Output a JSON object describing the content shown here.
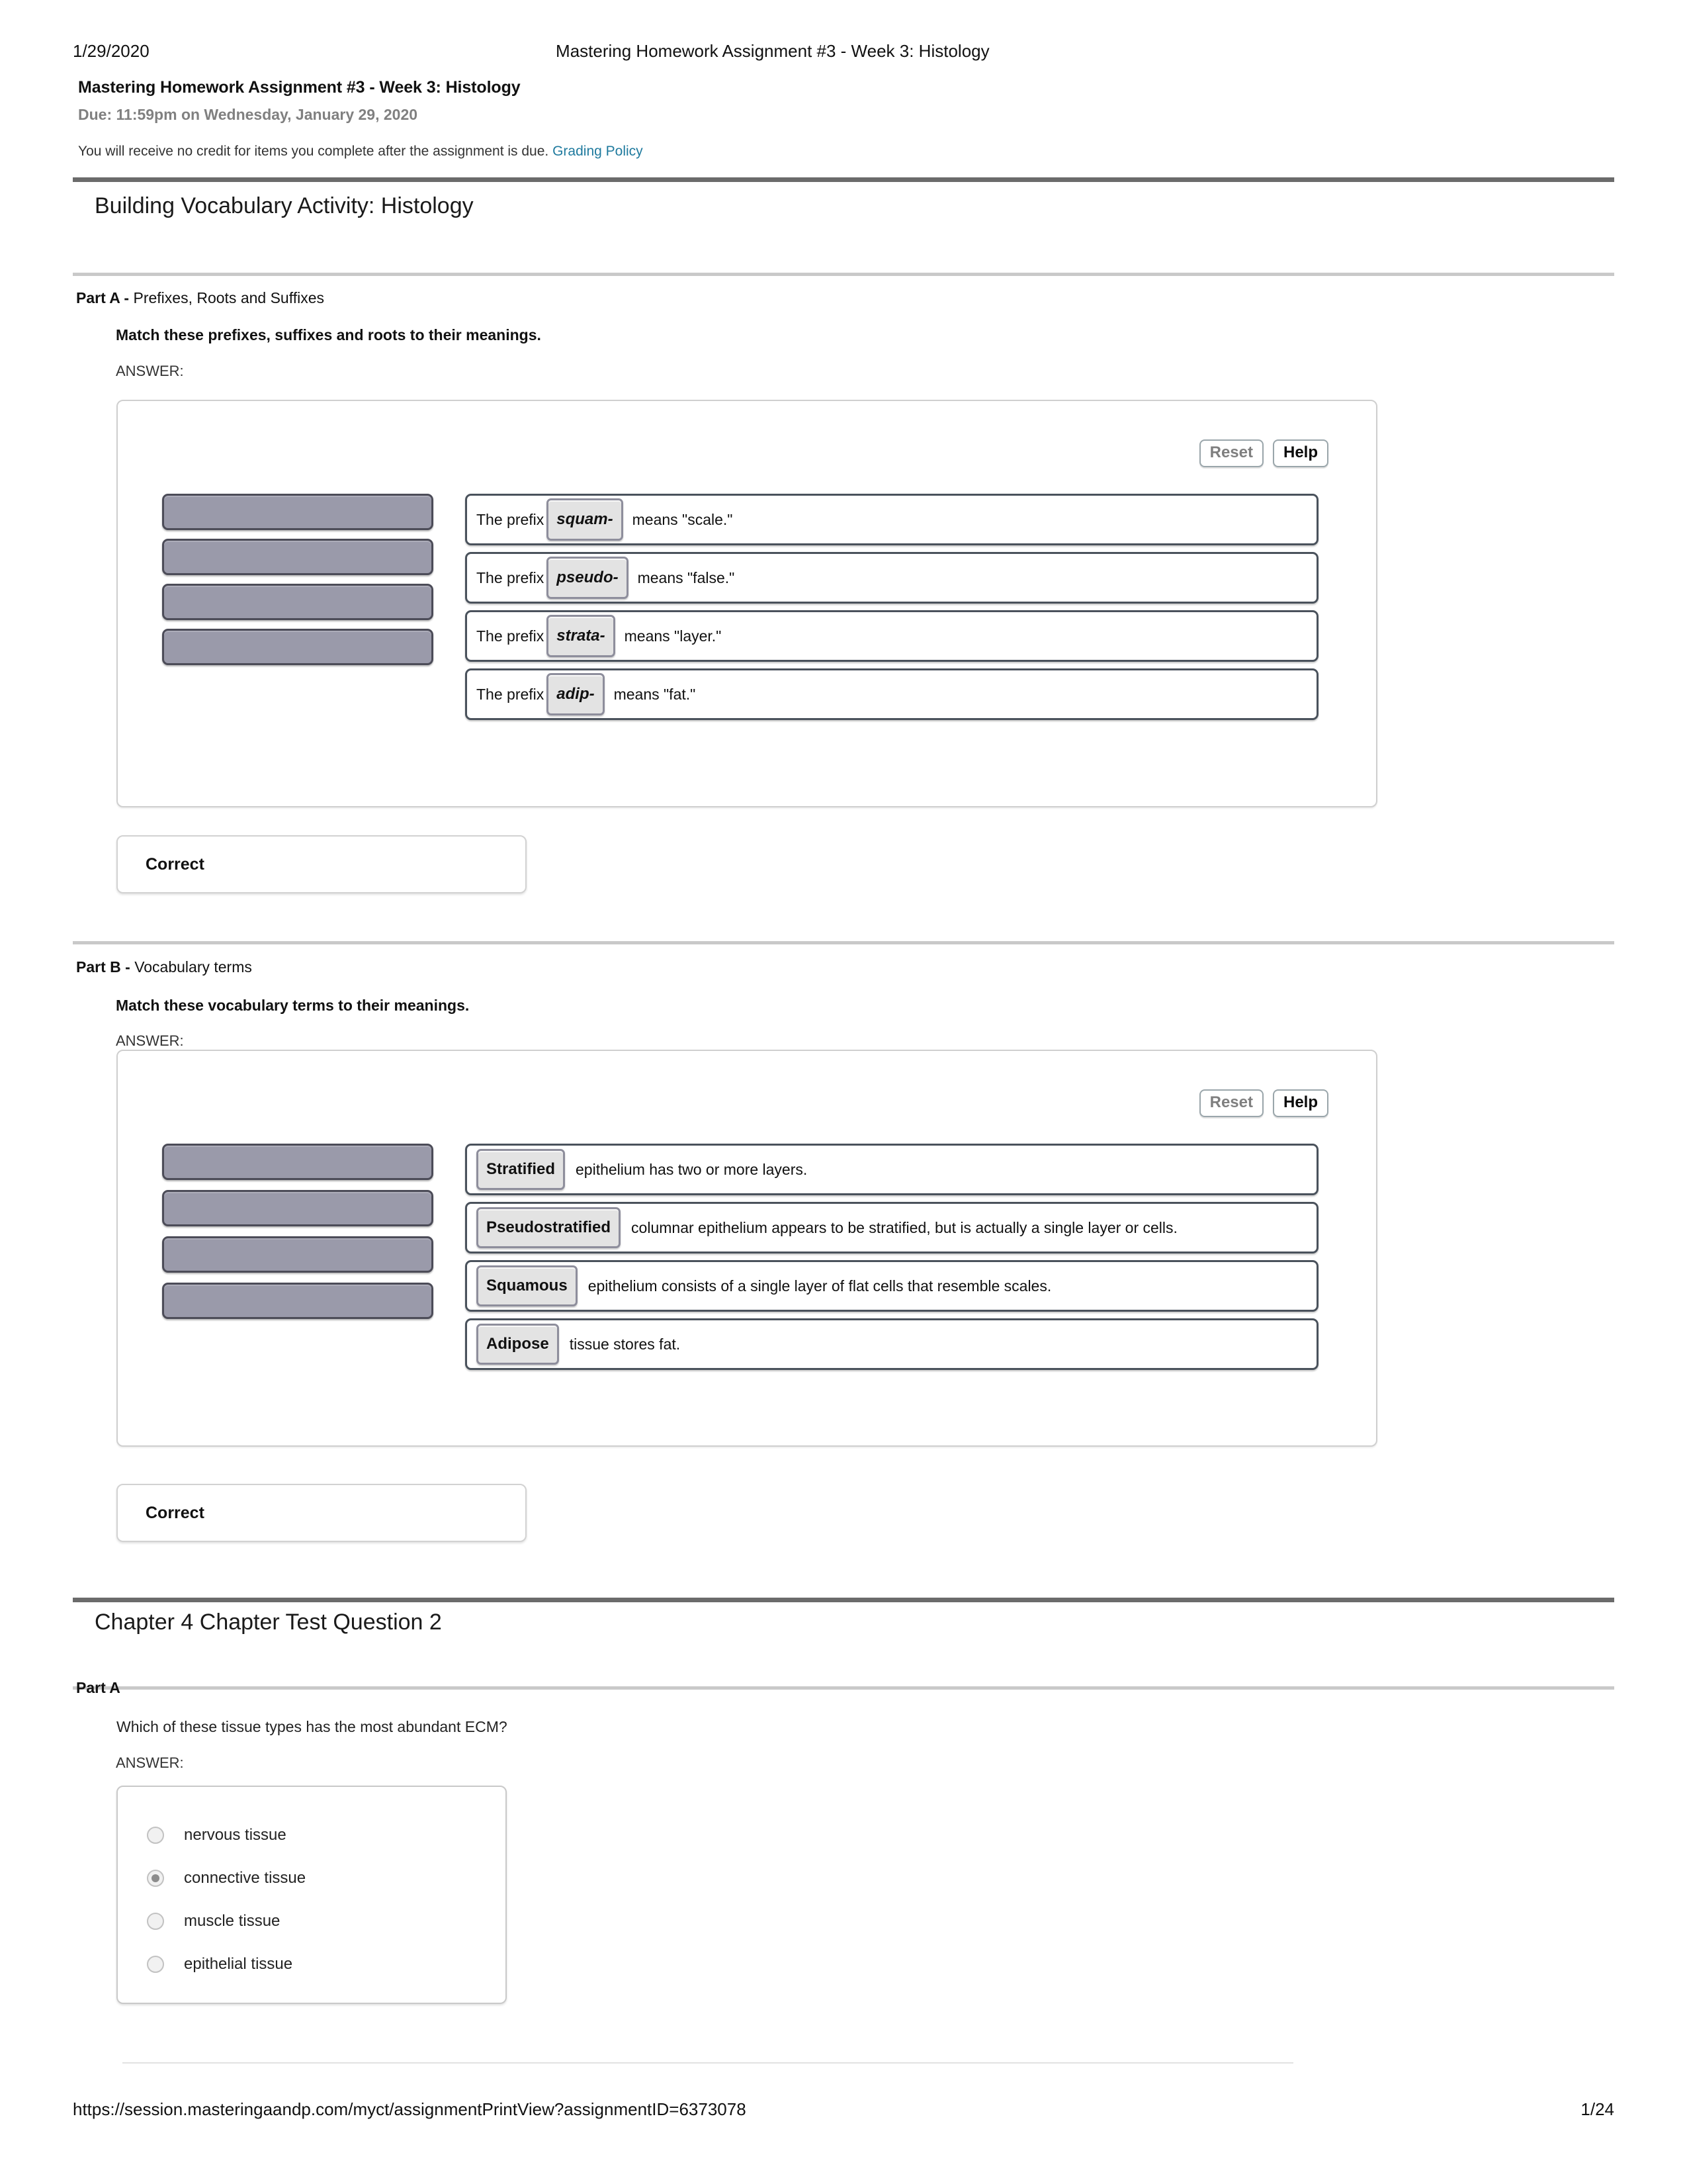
{
  "print_header": {
    "date": "1/29/2020",
    "document_title": "Mastering Homework Assignment #3 - Week 3: Histology"
  },
  "assignment": {
    "name": "Mastering Homework Assignment #3 - Week 3: Histology",
    "due": "Due: 11:59pm on Wednesday, January 29, 2020",
    "note": "You will receive no credit for items you complete after the assignment is due.",
    "grading_policy_link": "Grading Policy"
  },
  "items": [
    {
      "title": "Building Vocabulary Activity: Histology",
      "parts": [
        {
          "label": "Part A -",
          "description": "Prefixes, Roots and Suffixes",
          "prompt": "Match these prefixes, suffixes and roots to their meanings.",
          "answer_label": "ANSWER:",
          "panel": {
            "reset_button": "Reset",
            "help_button": "Help",
            "bank_slots": [
              "",
              "",
              "",
              ""
            ],
            "targets": [
              {
                "lead": "The prefix",
                "chip": "squam-",
                "trail": "means \"scale.\""
              },
              {
                "lead": "The prefix",
                "chip": "pseudo-",
                "trail": "means \"false.\""
              },
              {
                "lead": "The prefix",
                "chip": "strata-",
                "trail": "means \"layer.\""
              },
              {
                "lead": "The prefix",
                "chip": "adip-",
                "trail": "means \"fat.\""
              }
            ]
          },
          "feedback": "Correct"
        },
        {
          "label": "Part B -",
          "description": "Vocabulary terms",
          "prompt": "Match these vocabulary terms to their meanings.",
          "answer_label": "ANSWER:",
          "panel": {
            "reset_button": "Reset",
            "help_button": "Help",
            "bank_slots": [
              "",
              "",
              "",
              ""
            ],
            "targets": [
              {
                "lead": "",
                "chip": "Stratified",
                "trail": "epithelium has two or more layers."
              },
              {
                "lead": "",
                "chip": "Pseudostratified",
                "trail": "columnar epithelium appears to be stratified, but is actually a single layer or cells."
              },
              {
                "lead": "",
                "chip": "Squamous",
                "trail": "epithelium consists of a single layer of flat cells that resemble scales."
              },
              {
                "lead": "",
                "chip": "Adipose",
                "trail": "tissue stores fat."
              }
            ]
          },
          "feedback": "Correct"
        }
      ]
    },
    {
      "title": "Chapter 4 Chapter Test Question 2",
      "parts": [
        {
          "label": "Part A",
          "description": "",
          "question": "Which of these tissue types has the most abundant ECM?",
          "answer_label": "ANSWER:",
          "options": [
            {
              "label": "nervous tissue",
              "selected": false
            },
            {
              "label": "connective tissue",
              "selected": true
            },
            {
              "label": "muscle tissue",
              "selected": false
            },
            {
              "label": "epithelial tissue",
              "selected": false
            }
          ]
        }
      ]
    }
  ],
  "footer": {
    "url": "https://session.masteringaandp.com/myct/assignmentPrintView?assignmentID=6373078",
    "page": "1/24"
  },
  "colors": {
    "link": "#1f7a9e",
    "bank_slot": "#9a9aaa",
    "rule_thick": "#6b6b6b",
    "rule_thin": "#c9c9c9",
    "chip_bg": "#e3e3e3"
  }
}
